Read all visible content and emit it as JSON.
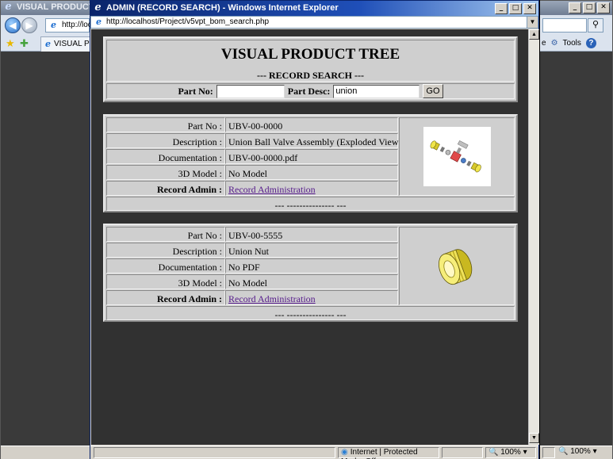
{
  "bg_window": {
    "title": "VISUAL PRODUCT TR",
    "url": "http://loc",
    "tab_label": "VISUAL PROD",
    "tools_prefix": "e",
    "tools_label": "Tools",
    "help_label": "?",
    "status_zoom": "100%"
  },
  "window": {
    "title": "ADMIN (RECORD SEARCH) - Windows Internet Explorer",
    "url": "http://localhost/Project/v5vpt_bom_search.php",
    "status_zone": "Internet | Protected Mode: Off",
    "status_zoom": "100%"
  },
  "header": {
    "title": "VISUAL PRODUCT TREE",
    "subtitle": "--- RECORD SEARCH ---"
  },
  "search": {
    "part_no_label": "Part No:",
    "part_no_value": "",
    "part_desc_label": "Part Desc:",
    "part_desc_value": "union",
    "go_label": "GO"
  },
  "labels": {
    "part_no": "Part No :",
    "description": "Description :",
    "documentation": "Documentation :",
    "model_3d": "3D Model :",
    "record_admin": "Record Admin :"
  },
  "records": [
    {
      "part_no": "UBV-00-0000",
      "description": "Union Ball Valve Assembly (Exploded View)",
      "documentation": "UBV-00-0000.pdf",
      "model_3d": "No Model",
      "record_admin": "Record Administration",
      "footer": "--- --------------- ---"
    },
    {
      "part_no": "UBV-00-5555",
      "description": "Union Nut",
      "documentation": "No PDF",
      "model_3d": "No Model",
      "record_admin": "Record Administration",
      "footer": "--- --------------- ---"
    }
  ]
}
